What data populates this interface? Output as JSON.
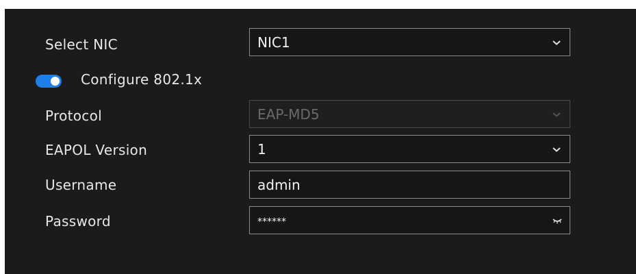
{
  "form": {
    "nic": {
      "label": "Select NIC",
      "value": "NIC1"
    },
    "dot1x": {
      "label": "Configure 802.1x",
      "enabled": true
    },
    "protocol": {
      "label": "Protocol",
      "value": "EAP-MD5",
      "disabled": true
    },
    "eapol": {
      "label": "EAPOL Version",
      "value": "1"
    },
    "username": {
      "label": "Username",
      "value": "admin"
    },
    "password": {
      "label": "Password",
      "value": "******"
    }
  },
  "icons": {
    "dropdown": "chevron-down-icon",
    "password_toggle": "eye-closed-icon"
  },
  "colors": {
    "panel_background": "#1b1b1b",
    "toggle_on": "#1e7fe8",
    "field_border": "#8c8c8c"
  }
}
